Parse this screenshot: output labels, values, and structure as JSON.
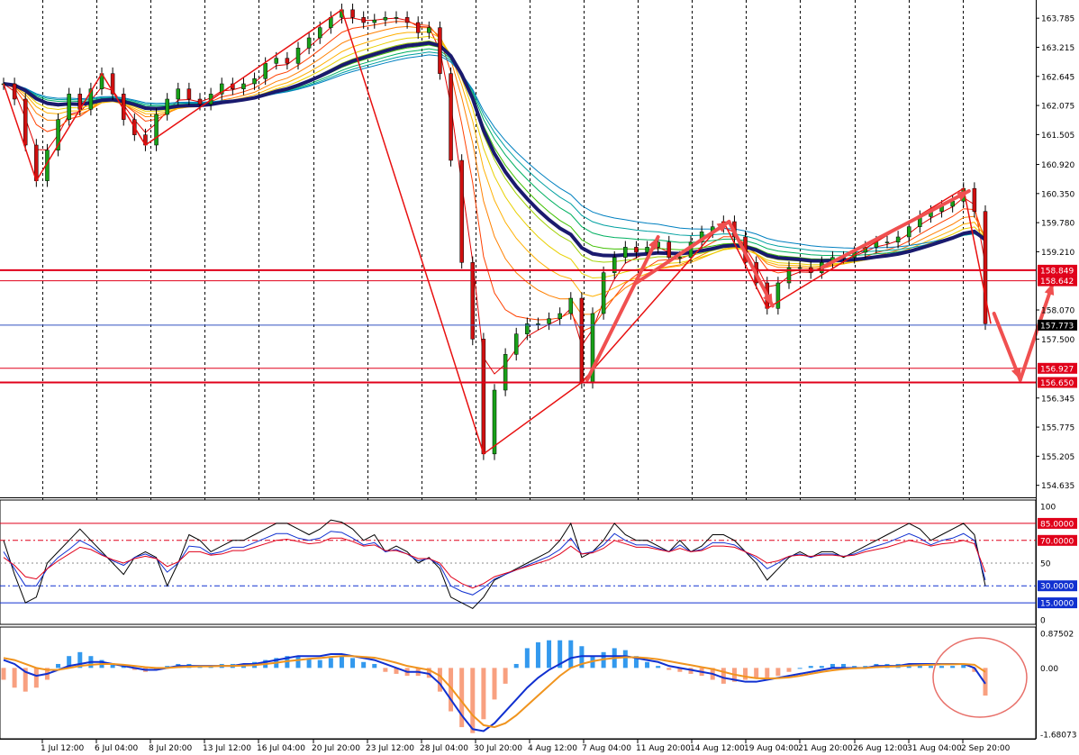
{
  "chart_data": [
    {
      "type": "candlestick",
      "title": "",
      "price_axis": {
        "ticks": [
          "163.785",
          "163.215",
          "162.645",
          "162.075",
          "161.505",
          "160.920",
          "160.350",
          "159.780",
          "159.210",
          "158.070",
          "157.500",
          "156.345",
          "155.775",
          "155.205",
          "154.635"
        ],
        "range": [
          154.4,
          164.0
        ]
      },
      "time_axis": {
        "ticks": [
          "1 Jul 12:00",
          "6 Jul 04:00",
          "8 Jul 20:00",
          "13 Jul 12:00",
          "16 Jul 04:00",
          "20 Jul 20:00",
          "23 Jul 12:00",
          "28 Jul 04:00",
          "30 Jul 20:00",
          "4 Aug 12:00",
          "7 Aug 04:00",
          "11 Aug 20:00",
          "14 Aug 12:00",
          "19 Aug 04:00",
          "21 Aug 20:00",
          "26 Aug 12:00",
          "31 Aug 04:00",
          "2 Sep 20:00"
        ]
      },
      "levels": [
        {
          "value": 158.849,
          "label": "158.849",
          "color": "#e0001a"
        },
        {
          "value": 158.642,
          "label": "158.642",
          "color": "#e0001a"
        },
        {
          "value": 157.773,
          "label": "157.773",
          "color": "#000000"
        },
        {
          "value": 156.927,
          "label": "156.927",
          "color": "#e0001a"
        },
        {
          "value": 156.65,
          "label": "156.650",
          "color": "#e0001a"
        }
      ],
      "zigzag_points": [
        {
          "t": 0,
          "p": 162.5
        },
        {
          "t": 3,
          "p": 160.6
        },
        {
          "t": 9,
          "p": 162.7
        },
        {
          "t": 13,
          "p": 161.3
        },
        {
          "t": 31,
          "p": 163.95
        },
        {
          "t": 44,
          "p": 155.25
        },
        {
          "t": 53,
          "p": 156.65
        },
        {
          "t": 66,
          "p": 159.8
        },
        {
          "t": 70,
          "p": 158.1
        },
        {
          "t": 88,
          "p": 160.45
        },
        {
          "t": 90.5,
          "p": 157.8
        }
      ],
      "close_series": [
        162.5,
        162.2,
        161.3,
        160.6,
        161.2,
        161.8,
        162.3,
        162.0,
        162.4,
        162.7,
        162.3,
        161.8,
        161.5,
        161.3,
        161.9,
        162.2,
        162.4,
        162.2,
        162.1,
        162.3,
        162.5,
        162.4,
        162.5,
        162.6,
        162.9,
        163.0,
        162.9,
        163.2,
        163.4,
        163.6,
        163.8,
        163.95,
        163.8,
        163.7,
        163.75,
        163.8,
        163.8,
        163.7,
        163.5,
        163.6,
        162.7,
        161.0,
        159.0,
        157.5,
        155.25,
        156.5,
        157.2,
        157.6,
        157.8,
        157.8,
        157.9,
        158.0,
        158.3,
        156.65,
        158.0,
        158.8,
        159.1,
        159.3,
        159.2,
        159.3,
        159.4,
        159.1,
        159.1,
        159.4,
        159.6,
        159.7,
        159.8,
        159.5,
        159.0,
        158.6,
        158.1,
        158.6,
        158.9,
        158.9,
        158.8,
        159.0,
        159.1,
        159.1,
        159.2,
        159.3,
        159.4,
        159.4,
        159.5,
        159.7,
        159.9,
        160.0,
        160.1,
        160.2,
        160.45,
        160.0,
        157.8
      ],
      "projection_arrows": [
        {
          "from": [
            53.5,
            156.7
          ],
          "to": [
            60.0,
            159.5
          ]
        },
        {
          "from": [
            58.0,
            158.6
          ],
          "to": [
            66.5,
            159.8
          ]
        },
        {
          "from": [
            66.5,
            159.8
          ],
          "to": [
            70.5,
            158.15
          ]
        },
        {
          "from": [
            75.0,
            158.9
          ],
          "to": [
            88.5,
            160.4
          ]
        },
        {
          "from": [
            90.8,
            158.0
          ],
          "to": [
            93.2,
            156.7
          ]
        },
        {
          "from": [
            93.2,
            156.7
          ],
          "to": [
            96.2,
            158.6
          ]
        }
      ]
    },
    {
      "type": "line",
      "name": "oscillator",
      "ticks": [
        "100",
        "85.0000",
        "70.0000",
        "50",
        "30.0000",
        "15.0000",
        "0"
      ],
      "levels": [
        {
          "value": 85,
          "label": "85.0000",
          "color": "#e0001a"
        },
        {
          "value": 70,
          "label": "70.0000",
          "color": "#e0001a"
        },
        {
          "value": 30,
          "label": "30.0000",
          "color": "#1030d0"
        },
        {
          "value": 15,
          "label": "15.0000",
          "color": "#1030d0"
        }
      ],
      "range": [
        0,
        100
      ],
      "series": [
        {
          "color": "#000000",
          "values": [
            70,
            40,
            15,
            20,
            50,
            60,
            70,
            80,
            70,
            60,
            50,
            40,
            55,
            60,
            55,
            30,
            50,
            75,
            70,
            60,
            65,
            70,
            70,
            75,
            80,
            85,
            85,
            80,
            75,
            80,
            88,
            86,
            80,
            70,
            75,
            60,
            65,
            60,
            50,
            55,
            45,
            20,
            15,
            10,
            20,
            35,
            40,
            45,
            50,
            55,
            60,
            70,
            85,
            55,
            60,
            70,
            85,
            75,
            70,
            70,
            65,
            60,
            70,
            60,
            65,
            75,
            75,
            70,
            60,
            50,
            35,
            45,
            55,
            60,
            55,
            60,
            60,
            55,
            60,
            65,
            70,
            75,
            80,
            85,
            80,
            70,
            75,
            80,
            85,
            75,
            30
          ]
        },
        {
          "color": "#1030d0",
          "values": [
            60,
            45,
            30,
            30,
            45,
            55,
            62,
            70,
            65,
            58,
            52,
            48,
            55,
            58,
            54,
            42,
            50,
            65,
            64,
            58,
            60,
            64,
            64,
            68,
            72,
            76,
            76,
            72,
            70,
            72,
            78,
            77,
            72,
            66,
            68,
            60,
            62,
            58,
            52,
            54,
            48,
            30,
            25,
            22,
            28,
            36,
            40,
            44,
            48,
            52,
            56,
            62,
            72,
            58,
            60,
            66,
            76,
            70,
            66,
            66,
            63,
            60,
            66,
            60,
            62,
            68,
            68,
            66,
            60,
            54,
            45,
            50,
            56,
            58,
            55,
            58,
            58,
            56,
            58,
            62,
            65,
            68,
            72,
            76,
            72,
            66,
            70,
            72,
            76,
            70,
            35
          ]
        },
        {
          "color": "#e0001a",
          "values": [
            55,
            48,
            38,
            36,
            45,
            52,
            58,
            64,
            62,
            57,
            53,
            50,
            54,
            56,
            54,
            47,
            51,
            60,
            60,
            57,
            58,
            61,
            61,
            64,
            67,
            70,
            71,
            69,
            67,
            68,
            72,
            72,
            69,
            65,
            66,
            61,
            61,
            58,
            54,
            54,
            50,
            38,
            32,
            28,
            32,
            38,
            41,
            44,
            47,
            50,
            53,
            58,
            65,
            58,
            59,
            63,
            70,
            67,
            64,
            64,
            62,
            60,
            63,
            60,
            61,
            65,
            65,
            64,
            60,
            56,
            50,
            52,
            56,
            57,
            56,
            57,
            57,
            56,
            57,
            60,
            62,
            64,
            67,
            70,
            68,
            65,
            67,
            68,
            70,
            67,
            42
          ]
        }
      ]
    },
    {
      "type": "bar",
      "name": "macd",
      "ticks": [
        "0.87502",
        "0.00",
        "-1.68073"
      ],
      "range": [
        -1.68073,
        0.87502
      ],
      "histogram": [
        -0.3,
        -0.5,
        -0.6,
        -0.5,
        -0.3,
        0.1,
        0.3,
        0.4,
        0.3,
        0.2,
        0.1,
        0.05,
        -0.05,
        -0.1,
        -0.05,
        0.05,
        0.1,
        0.1,
        0.05,
        0.05,
        0.1,
        0.1,
        0.1,
        0.15,
        0.2,
        0.25,
        0.3,
        0.3,
        0.25,
        0.2,
        0.25,
        0.3,
        0.25,
        0.15,
        0.1,
        -0.1,
        -0.15,
        -0.2,
        -0.2,
        -0.25,
        -0.6,
        -1.1,
        -1.5,
        -1.65,
        -1.3,
        -0.8,
        -0.4,
        0.1,
        0.5,
        0.65,
        0.7,
        0.7,
        0.7,
        0.55,
        0.3,
        0.4,
        0.5,
        0.45,
        0.3,
        0.15,
        0.05,
        -0.05,
        -0.1,
        -0.15,
        -0.2,
        -0.3,
        -0.4,
        -0.35,
        -0.3,
        -0.25,
        -0.3,
        -0.2,
        -0.1,
        0.0,
        0.05,
        0.05,
        0.1,
        0.1,
        0.05,
        0.05,
        0.1,
        0.1,
        0.1,
        0.1,
        0.1,
        0.05,
        0.05,
        0.05,
        0.1,
        -0.1,
        -0.7
      ],
      "series": [
        {
          "color": "#1030d0",
          "values": [
            0.2,
            0.1,
            -0.1,
            -0.2,
            -0.15,
            -0.05,
            0.05,
            0.1,
            0.15,
            0.15,
            0.1,
            0.05,
            0.0,
            -0.05,
            -0.05,
            0.0,
            0.05,
            0.05,
            0.05,
            0.05,
            0.05,
            0.05,
            0.1,
            0.1,
            0.15,
            0.2,
            0.25,
            0.3,
            0.3,
            0.3,
            0.35,
            0.35,
            0.3,
            0.25,
            0.2,
            0.1,
            0.0,
            -0.1,
            -0.1,
            -0.15,
            -0.4,
            -0.8,
            -1.2,
            -1.55,
            -1.6,
            -1.4,
            -1.1,
            -0.8,
            -0.5,
            -0.25,
            -0.05,
            0.1,
            0.25,
            0.3,
            0.3,
            0.3,
            0.3,
            0.3,
            0.25,
            0.2,
            0.15,
            0.05,
            0.0,
            -0.05,
            -0.1,
            -0.15,
            -0.25,
            -0.3,
            -0.35,
            -0.35,
            -0.3,
            -0.25,
            -0.2,
            -0.15,
            -0.1,
            -0.05,
            0.0,
            0.0,
            0.0,
            0.0,
            0.05,
            0.05,
            0.05,
            0.1,
            0.1,
            0.1,
            0.1,
            0.1,
            0.1,
            0.0,
            -0.4
          ]
        },
        {
          "color": "#f0941e",
          "values": [
            0.25,
            0.2,
            0.1,
            0.0,
            -0.05,
            -0.05,
            0.0,
            0.05,
            0.08,
            0.1,
            0.1,
            0.08,
            0.05,
            0.02,
            0.0,
            0.0,
            0.02,
            0.03,
            0.04,
            0.04,
            0.05,
            0.05,
            0.06,
            0.07,
            0.1,
            0.13,
            0.17,
            0.2,
            0.23,
            0.25,
            0.28,
            0.3,
            0.3,
            0.28,
            0.26,
            0.2,
            0.13,
            0.05,
            0.0,
            -0.05,
            -0.2,
            -0.5,
            -0.85,
            -1.2,
            -1.45,
            -1.5,
            -1.4,
            -1.2,
            -0.95,
            -0.7,
            -0.45,
            -0.2,
            0.0,
            0.1,
            0.17,
            0.22,
            0.25,
            0.27,
            0.27,
            0.25,
            0.22,
            0.17,
            0.12,
            0.07,
            0.02,
            -0.03,
            -0.1,
            -0.17,
            -0.22,
            -0.26,
            -0.27,
            -0.26,
            -0.24,
            -0.2,
            -0.15,
            -0.1,
            -0.06,
            -0.03,
            -0.01,
            0.0,
            0.02,
            0.03,
            0.04,
            0.06,
            0.07,
            0.08,
            0.09,
            0.09,
            0.1,
            0.08,
            -0.1
          ]
        }
      ]
    }
  ]
}
